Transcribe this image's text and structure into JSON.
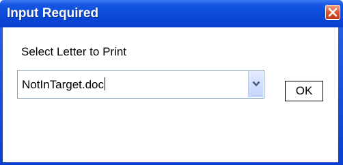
{
  "window": {
    "title": "Input Required"
  },
  "dialog": {
    "prompt": "Select Letter to Print",
    "combo": {
      "value": "NotInTarget.doc"
    },
    "ok_label": "OK"
  },
  "icons": {
    "close": "close-icon",
    "dropdown": "chevron-down-icon"
  }
}
